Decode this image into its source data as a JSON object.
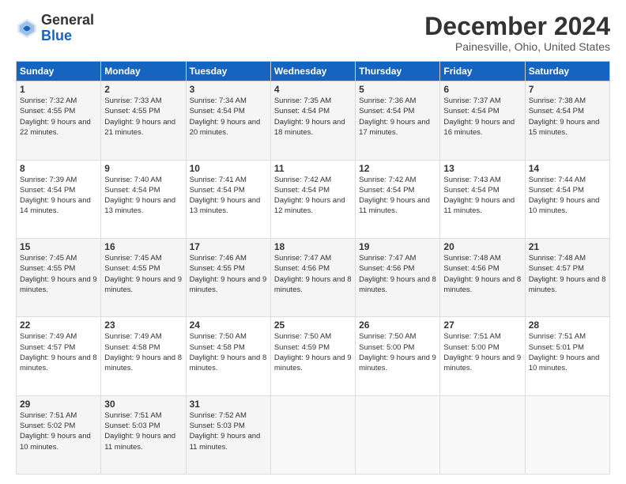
{
  "logo": {
    "general": "General",
    "blue": "Blue"
  },
  "header": {
    "month": "December 2024",
    "location": "Painesville, Ohio, United States"
  },
  "weekdays": [
    "Sunday",
    "Monday",
    "Tuesday",
    "Wednesday",
    "Thursday",
    "Friday",
    "Saturday"
  ],
  "weeks": [
    [
      {
        "day": "1",
        "sunrise": "7:32 AM",
        "sunset": "4:55 PM",
        "daylight": "9 hours and 22 minutes."
      },
      {
        "day": "2",
        "sunrise": "7:33 AM",
        "sunset": "4:55 PM",
        "daylight": "9 hours and 21 minutes."
      },
      {
        "day": "3",
        "sunrise": "7:34 AM",
        "sunset": "4:54 PM",
        "daylight": "9 hours and 20 minutes."
      },
      {
        "day": "4",
        "sunrise": "7:35 AM",
        "sunset": "4:54 PM",
        "daylight": "9 hours and 18 minutes."
      },
      {
        "day": "5",
        "sunrise": "7:36 AM",
        "sunset": "4:54 PM",
        "daylight": "9 hours and 17 minutes."
      },
      {
        "day": "6",
        "sunrise": "7:37 AM",
        "sunset": "4:54 PM",
        "daylight": "9 hours and 16 minutes."
      },
      {
        "day": "7",
        "sunrise": "7:38 AM",
        "sunset": "4:54 PM",
        "daylight": "9 hours and 15 minutes."
      }
    ],
    [
      {
        "day": "8",
        "sunrise": "7:39 AM",
        "sunset": "4:54 PM",
        "daylight": "9 hours and 14 minutes."
      },
      {
        "day": "9",
        "sunrise": "7:40 AM",
        "sunset": "4:54 PM",
        "daylight": "9 hours and 13 minutes."
      },
      {
        "day": "10",
        "sunrise": "7:41 AM",
        "sunset": "4:54 PM",
        "daylight": "9 hours and 13 minutes."
      },
      {
        "day": "11",
        "sunrise": "7:42 AM",
        "sunset": "4:54 PM",
        "daylight": "9 hours and 12 minutes."
      },
      {
        "day": "12",
        "sunrise": "7:42 AM",
        "sunset": "4:54 PM",
        "daylight": "9 hours and 11 minutes."
      },
      {
        "day": "13",
        "sunrise": "7:43 AM",
        "sunset": "4:54 PM",
        "daylight": "9 hours and 11 minutes."
      },
      {
        "day": "14",
        "sunrise": "7:44 AM",
        "sunset": "4:54 PM",
        "daylight": "9 hours and 10 minutes."
      }
    ],
    [
      {
        "day": "15",
        "sunrise": "7:45 AM",
        "sunset": "4:55 PM",
        "daylight": "9 hours and 9 minutes."
      },
      {
        "day": "16",
        "sunrise": "7:45 AM",
        "sunset": "4:55 PM",
        "daylight": "9 hours and 9 minutes."
      },
      {
        "day": "17",
        "sunrise": "7:46 AM",
        "sunset": "4:55 PM",
        "daylight": "9 hours and 9 minutes."
      },
      {
        "day": "18",
        "sunrise": "7:47 AM",
        "sunset": "4:56 PM",
        "daylight": "9 hours and 8 minutes."
      },
      {
        "day": "19",
        "sunrise": "7:47 AM",
        "sunset": "4:56 PM",
        "daylight": "9 hours and 8 minutes."
      },
      {
        "day": "20",
        "sunrise": "7:48 AM",
        "sunset": "4:56 PM",
        "daylight": "9 hours and 8 minutes."
      },
      {
        "day": "21",
        "sunrise": "7:48 AM",
        "sunset": "4:57 PM",
        "daylight": "9 hours and 8 minutes."
      }
    ],
    [
      {
        "day": "22",
        "sunrise": "7:49 AM",
        "sunset": "4:57 PM",
        "daylight": "9 hours and 8 minutes."
      },
      {
        "day": "23",
        "sunrise": "7:49 AM",
        "sunset": "4:58 PM",
        "daylight": "9 hours and 8 minutes."
      },
      {
        "day": "24",
        "sunrise": "7:50 AM",
        "sunset": "4:58 PM",
        "daylight": "9 hours and 8 minutes."
      },
      {
        "day": "25",
        "sunrise": "7:50 AM",
        "sunset": "4:59 PM",
        "daylight": "9 hours and 9 minutes."
      },
      {
        "day": "26",
        "sunrise": "7:50 AM",
        "sunset": "5:00 PM",
        "daylight": "9 hours and 9 minutes."
      },
      {
        "day": "27",
        "sunrise": "7:51 AM",
        "sunset": "5:00 PM",
        "daylight": "9 hours and 9 minutes."
      },
      {
        "day": "28",
        "sunrise": "7:51 AM",
        "sunset": "5:01 PM",
        "daylight": "9 hours and 10 minutes."
      }
    ],
    [
      {
        "day": "29",
        "sunrise": "7:51 AM",
        "sunset": "5:02 PM",
        "daylight": "9 hours and 10 minutes."
      },
      {
        "day": "30",
        "sunrise": "7:51 AM",
        "sunset": "5:03 PM",
        "daylight": "9 hours and 11 minutes."
      },
      {
        "day": "31",
        "sunrise": "7:52 AM",
        "sunset": "5:03 PM",
        "daylight": "9 hours and 11 minutes."
      },
      null,
      null,
      null,
      null
    ]
  ]
}
